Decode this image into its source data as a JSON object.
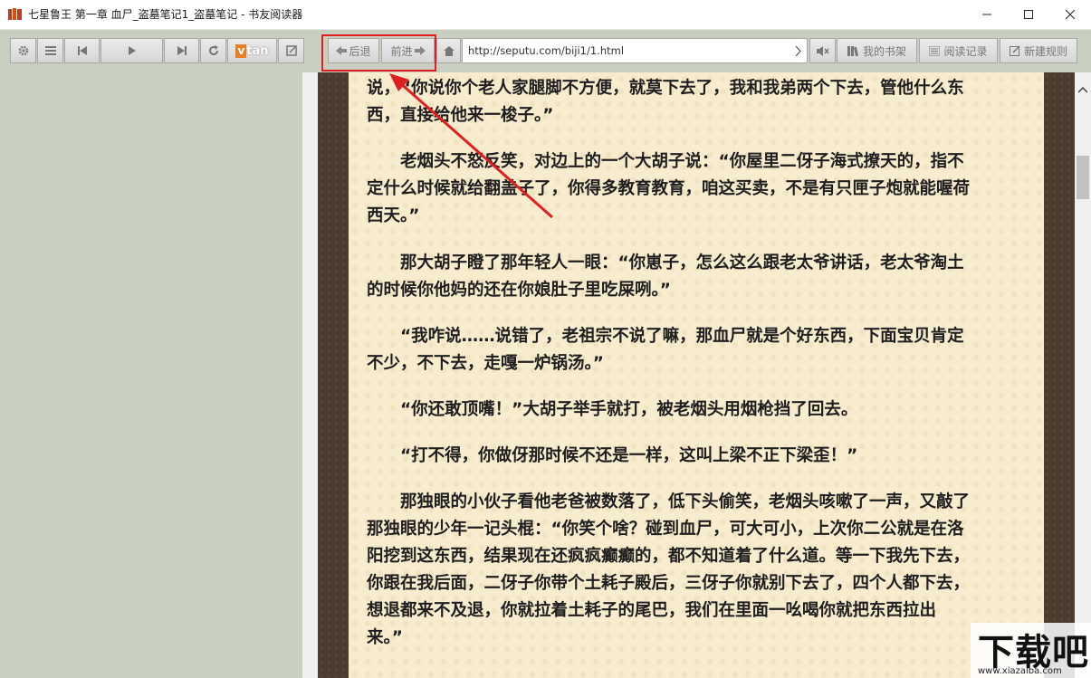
{
  "window": {
    "title": "七星鲁王 第一章 血尸_盗墓笔记1_盗墓笔记 - 书友阅读器",
    "minimize_label": "—",
    "maximize_label": "☐",
    "close_label": "✕"
  },
  "toolbar": {
    "left_buttons": [
      {
        "icon": "gear-icon"
      },
      {
        "icon": "menu-icon"
      },
      {
        "icon": "skip-prev-icon"
      },
      {
        "icon": "play-icon"
      },
      {
        "icon": "skip-next-icon"
      },
      {
        "icon": "refresh-icon"
      },
      {
        "icon": "vtan-logo",
        "label": "tan",
        "badge": "v"
      },
      {
        "icon": "exit-fullscreen-icon"
      }
    ],
    "back_label": "后退",
    "forward_label": "前进",
    "url": "http://seputu.com/biji1/1.html",
    "bookshelf_label": "我的书架",
    "history_label": "阅读记录",
    "new_rule_label": "新建规则"
  },
  "content": {
    "paragraphs": [
      [
        "说，“你说你个老人家腿脚不方便，就莫下去了，我和我弟两个下去，管他什么东",
        "西，直接给他来一梭子。”"
      ],
      [
        "　　老烟头不怒反笑，对边上的一个大胡子说：“你屋里二伢子海式撩天的，指不",
        "定什么时候就给翻盖子了，你得多教育教育，咱这买卖，不是有只匣子炮就能喔荷",
        "西天。”"
      ],
      [
        "　　那大胡子瞪了那年轻人一眼：“你崽子，怎么这么跟老太爷讲话，老太爷淘土",
        "的时候你他妈的还在你娘肚子里吃屎咧。”"
      ],
      [
        "　　“我咋说……说错了，老祖宗不说了嘛，那血尸就是个好东西，下面宝贝肯定",
        "不少，不下去，走嘎一炉锅汤。”"
      ],
      [
        "　　“你还敢顶嘴！”大胡子举手就打，被老烟头用烟枪挡了回去。"
      ],
      [
        "　　“打不得，你做伢那时候不还是一样，这叫上梁不正下梁歪！”"
      ],
      [
        "　　那独眼的小伙子看他老爸被数落了，低下头偷笑，老烟头咳嗽了一声，又敲了",
        "那独眼的少年一记头棍：“你笑个啥？碰到血尸，可大可小，上次你二公就是在洛",
        "阳挖到这东西，结果现在还疯疯癫癫的，都不知道着了什么道。等一下我先下去，",
        "你跟在我后面，二伢子你带个土耗子殿后，三伢子你就别下去了，四个人都下去，",
        "想退都来不及退，你就拉着土耗子的尾巴，我们在里面一吆喝你就把东西拉出",
        "来。”"
      ]
    ]
  },
  "watermark": {
    "text": "下载吧",
    "url": "www.xiazaiba.com"
  },
  "colors": {
    "toolbar_bg": "#c8cfc0",
    "left_panel_bg": "#c8d0c0",
    "page_bg": "#f7eccd",
    "border_bg": "#4c3d30",
    "highlight": "#e02020"
  }
}
